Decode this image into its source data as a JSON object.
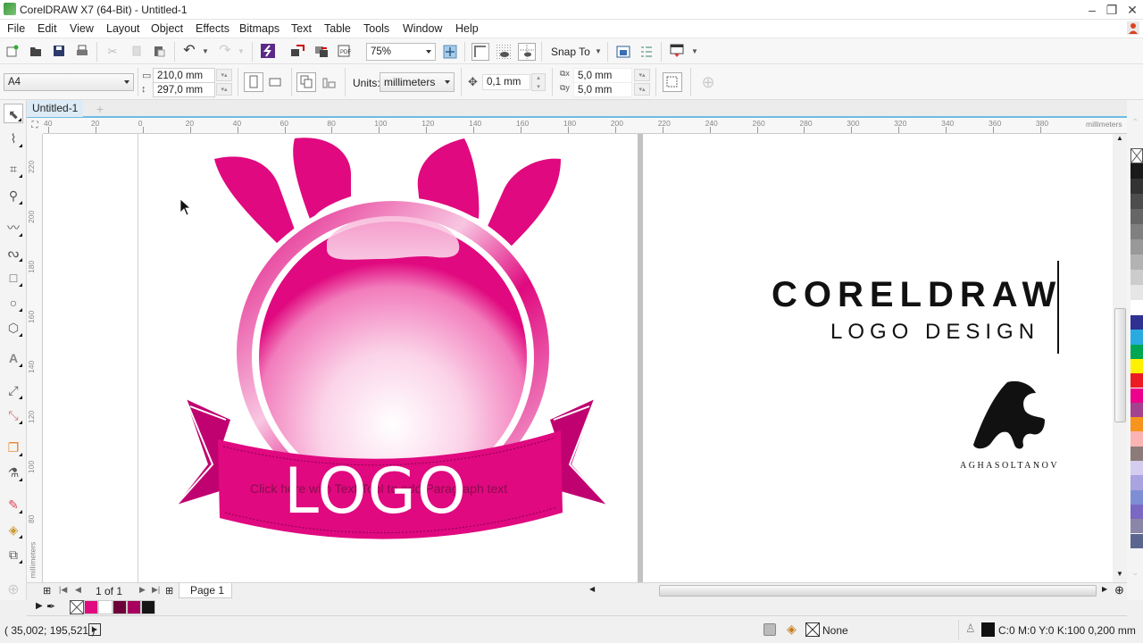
{
  "window": {
    "title": "CorelDRAW X7 (64-Bit) - Untitled-1",
    "controls": {
      "minimize": "–",
      "restore": "❐",
      "close": "✕"
    }
  },
  "menu": [
    "File",
    "Edit",
    "View",
    "Layout",
    "Object",
    "Effects",
    "Bitmaps",
    "Text",
    "Table",
    "Tools",
    "Window",
    "Help"
  ],
  "toolbar": {
    "icons": [
      "new-document",
      "open",
      "save",
      "print",
      "cut",
      "copy",
      "paste",
      "undo",
      "redo",
      "search-content",
      "import",
      "export",
      "publish-pdf"
    ],
    "zoom_level": "75%",
    "snap_to": "Snap To",
    "options": [
      "full-screen-preview",
      "show-rulers",
      "show-grid",
      "show-guidelines",
      "application-launcher",
      "options"
    ]
  },
  "property_bar": {
    "page_size": "A4",
    "width": "210,0 mm",
    "height": "297,0 mm",
    "units_label": "Units:",
    "units": "millimeters",
    "nudge": "0,1 mm",
    "dup_x": "5,0 mm",
    "dup_y": "5,0 mm"
  },
  "tabs": [
    {
      "label": "Untitled-1",
      "active": true
    }
  ],
  "rulers": {
    "unit": "millimeters",
    "horizontal": [
      "40",
      "20",
      "0",
      "20",
      "40",
      "60",
      "80",
      "100",
      "120",
      "140",
      "160",
      "180",
      "200",
      "220",
      "240",
      "260",
      "280",
      "300",
      "320",
      "340",
      "360",
      "380"
    ],
    "vertical": [
      "220",
      "200",
      "180",
      "160",
      "140",
      "120",
      "100",
      "80"
    ]
  },
  "toolbox": [
    "pick-tool",
    "shape-tool",
    "crop-tool",
    "zoom-tool",
    "freehand-tool",
    "artistic-media-tool",
    "rectangle-tool",
    "ellipse-tool",
    "polygon-tool",
    "text-tool",
    "parallel-dimension-tool",
    "connector-tool",
    "drop-shadow-tool",
    "transparency-tool",
    "color-eyedropper-tool",
    "interactive-fill-tool",
    "smart-fill-tool"
  ],
  "canvas": {
    "logo_text": "LOGO",
    "paragraph_hint": "Click here with Text Tool to add Paragraph text",
    "brand_title": "CORELDRAW",
    "brand_subtitle": "LOGO DESIGN",
    "signature": "AGHASOLTANOV",
    "logo_color": "#e0097f"
  },
  "navigator": {
    "page_count": "1 of 1",
    "page_tab": "Page 1"
  },
  "document_palette": [
    "none",
    "#e0097f",
    "#ffffff",
    "#6e0039",
    "#a8005e",
    "#161616"
  ],
  "color_palette": [
    "none",
    "#1a1a1a",
    "#333333",
    "#4d4d4d",
    "#666666",
    "#808080",
    "#999999",
    "#b3b3b3",
    "#cccccc",
    "#e6e6e6",
    "#ffffff",
    "#2e3192",
    "#29abe2",
    "#00a651",
    "#fff200",
    "#ed1c24",
    "#ec008c",
    "#a3428f",
    "#f7941d",
    "#fbb4b4",
    "#8c7b78",
    "#d4cdef",
    "#a9a3e0",
    "#7f8ed4",
    "#7b68c4",
    "#8a86a8",
    "#5b6690"
  ],
  "status": {
    "cursor_position": "( 35,002; 195,521 )",
    "fill": "None",
    "outline": "C:0 M:0 Y:0 K:100  0,200 mm"
  }
}
